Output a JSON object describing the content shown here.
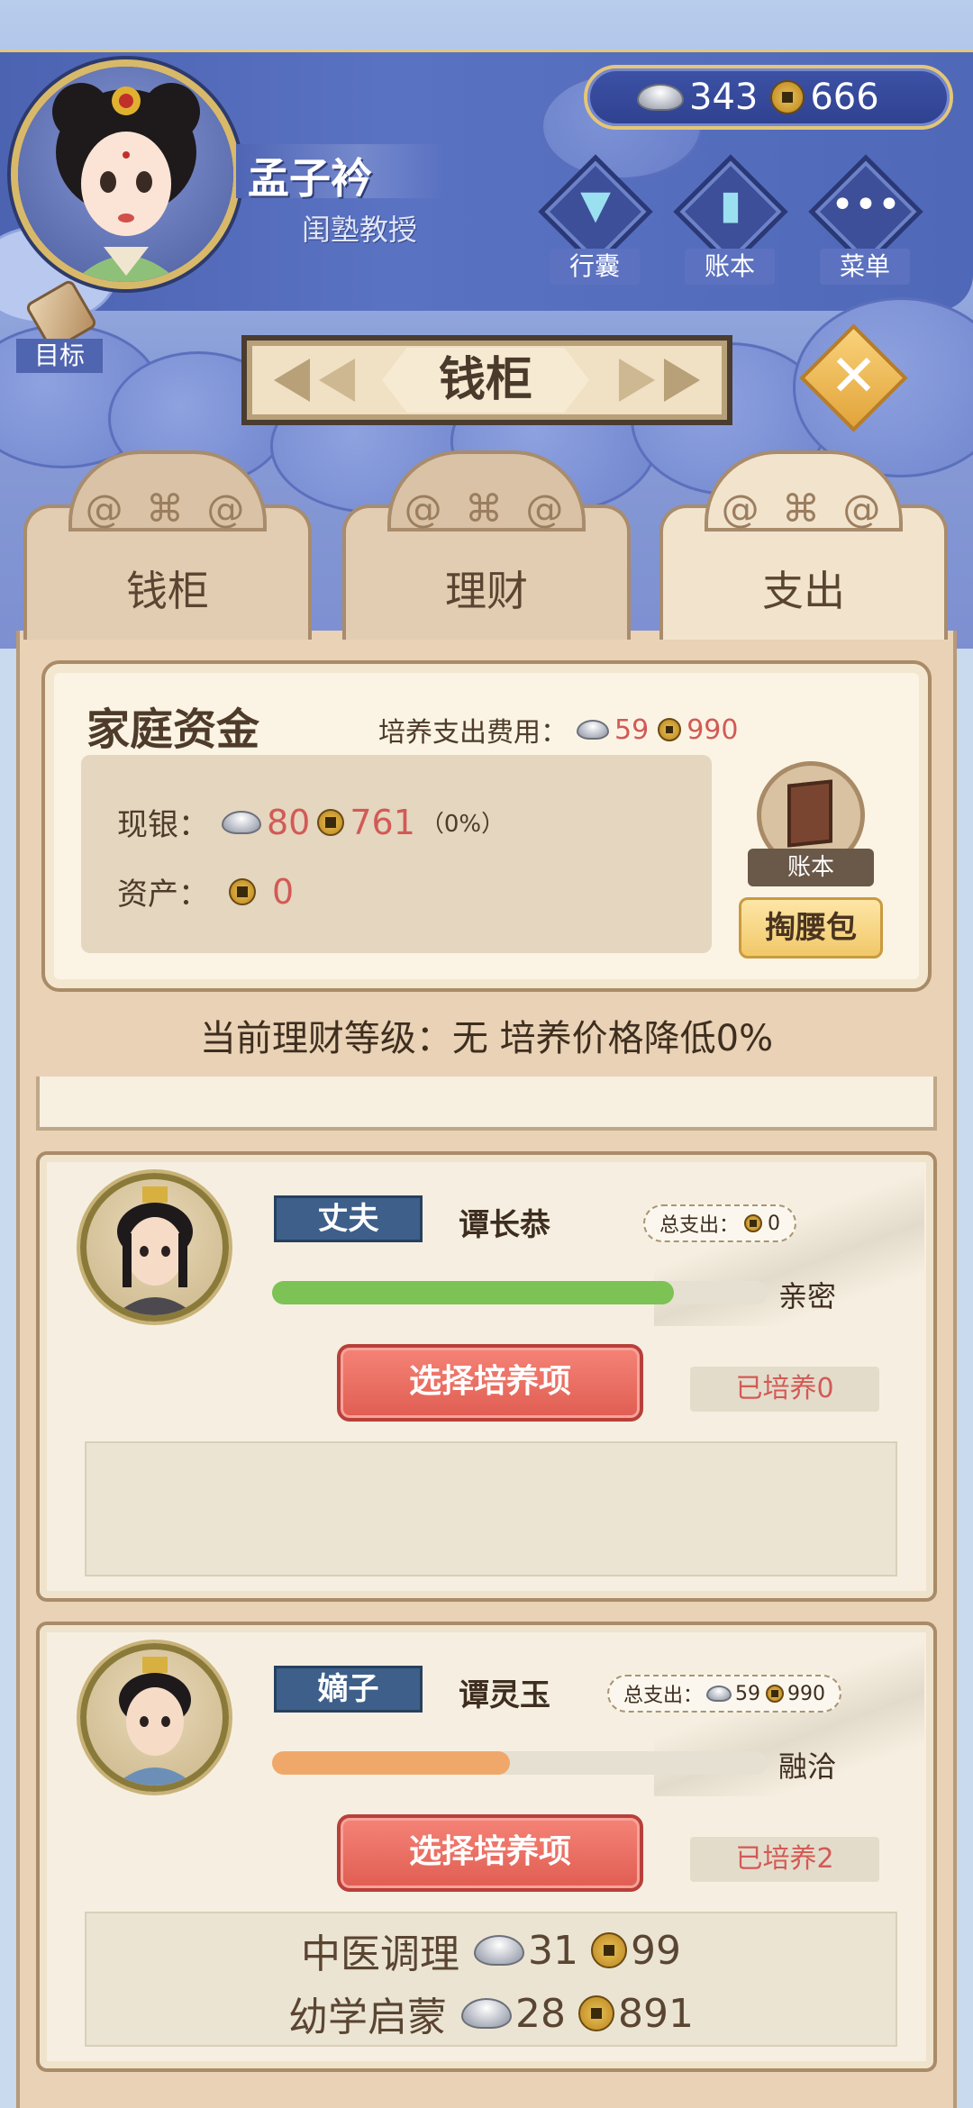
{
  "player": {
    "name": "孟子衿",
    "title": "闺塾教授"
  },
  "currency": {
    "silver": "343",
    "copper": "666"
  },
  "top_menu": [
    {
      "label": "行囊",
      "icon": "bag-icon"
    },
    {
      "label": "账本",
      "icon": "ledger-icon"
    },
    {
      "label": "菜单",
      "icon": "menu-dots-icon"
    }
  ],
  "goal_label": "目标",
  "page_title": "钱柜",
  "tabs": [
    {
      "label": "钱柜",
      "active": false
    },
    {
      "label": "理财",
      "active": false
    },
    {
      "label": "支出",
      "active": true
    }
  ],
  "fund": {
    "title": "家庭资金",
    "cost_label": "培养支出费用：",
    "cost_silver": "59",
    "cost_copper": "990",
    "cash_label": "现银：",
    "cash_silver": "80",
    "cash_copper": "761",
    "cash_pct": "（0%）",
    "asset_label": "资产：",
    "asset_copper": "0",
    "ledger_label": "账本",
    "pouch_label": "掏腰包"
  },
  "level_text": "当前理财等级：无 培养价格降低0%",
  "members": [
    {
      "role": "丈夫",
      "name": "谭长恭",
      "total_label": "总支出：",
      "total_silver": "",
      "total_copper": "0",
      "relation_label": "亲密",
      "relation_fraction": 0.81,
      "bar_color": "#7cc254",
      "choose_label": "选择培养项",
      "trained_label": "已培养0",
      "items": []
    },
    {
      "role": "嫡子",
      "name": "谭灵玉",
      "total_label": "总支出：",
      "total_silver": "59",
      "total_copper": "990",
      "relation_label": "融洽",
      "relation_fraction": 0.48,
      "bar_color": "#f0a86a",
      "choose_label": "选择培养项",
      "trained_label": "已培养2",
      "items": [
        {
          "name": "中医调理",
          "silver": "31",
          "copper": "99"
        },
        {
          "name": "幼学启蒙",
          "silver": "28",
          "copper": "891"
        }
      ]
    }
  ]
}
